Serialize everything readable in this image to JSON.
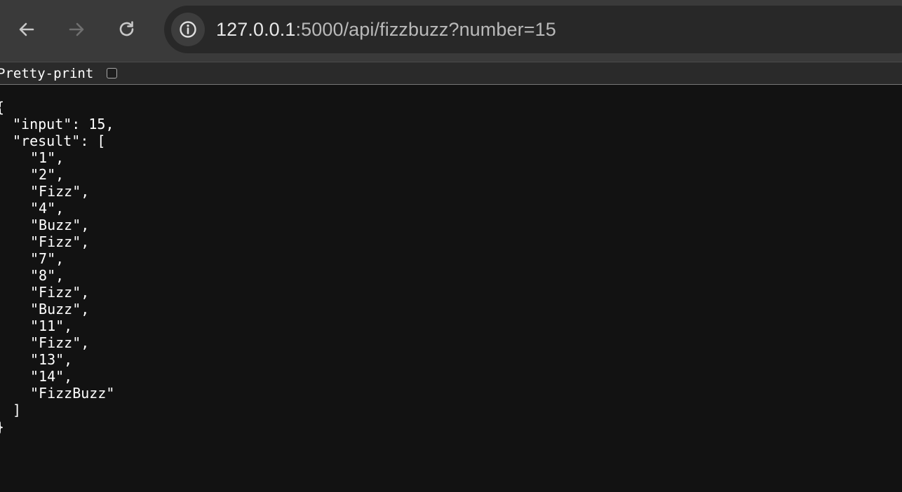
{
  "browser": {
    "url_host": "127.0.0.1",
    "url_rest": ":5000/api/fizzbuzz?number=15",
    "back_icon": "arrow-left-icon",
    "forward_icon": "arrow-right-icon",
    "reload_icon": "reload-icon",
    "site_info_icon": "info-circle-icon"
  },
  "viewer": {
    "pretty_print_label": "Pretty-print",
    "pretty_print_checked": false
  },
  "json": {
    "open_brace": "{",
    "input_line": "\"input\": 15,",
    "result_open": "\"result\": [",
    "items": [
      "\"1\",",
      "\"2\",",
      "\"Fizz\",",
      "\"4\",",
      "\"Buzz\",",
      "\"Fizz\",",
      "\"7\",",
      "\"8\",",
      "\"Fizz\",",
      "\"Buzz\",",
      "\"11\",",
      "\"Fizz\",",
      "\"13\",",
      "\"14\",",
      "\"FizzBuzz\""
    ],
    "result_close": "]",
    "close_brace": "}"
  },
  "colors": {
    "page_bg": "#121212",
    "toolbar_bg": "#3a3a3a",
    "omnibox_bg": "#282828",
    "text": "#ffffff"
  }
}
